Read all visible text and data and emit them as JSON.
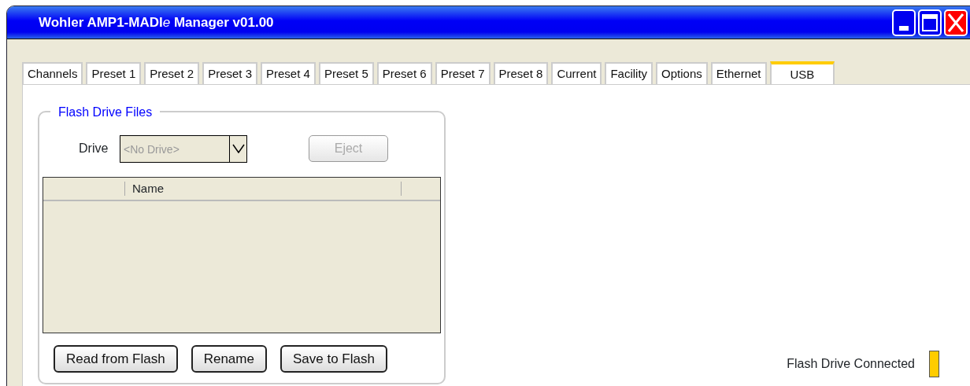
{
  "window": {
    "title": [
      {
        "text": "Wohler AMP1-MADI",
        "italic": false
      },
      {
        "text": "e",
        "italic": true
      },
      {
        "text": " Manager v01.00",
        "italic": false
      }
    ]
  },
  "tabs": [
    {
      "label": "Channels",
      "selected": false
    },
    {
      "label": "Preset 1",
      "selected": false
    },
    {
      "label": "Preset 2",
      "selected": false
    },
    {
      "label": "Preset 3",
      "selected": false
    },
    {
      "label": "Preset 4",
      "selected": false
    },
    {
      "label": "Preset 5",
      "selected": false
    },
    {
      "label": "Preset 6",
      "selected": false
    },
    {
      "label": "Preset 7",
      "selected": false
    },
    {
      "label": "Preset 8",
      "selected": false
    },
    {
      "label": "Current",
      "selected": false
    },
    {
      "label": "Facility",
      "selected": false
    },
    {
      "label": "Options",
      "selected": false
    },
    {
      "label": "Ethernet",
      "selected": false
    },
    {
      "label": "USB",
      "selected": true
    }
  ],
  "flash_drive_files": {
    "title": "Flash Drive Files",
    "drive_label": "Drive",
    "drive": {
      "value": "<No Drive>",
      "disabled": true
    },
    "eject": {
      "label": "Eject",
      "disabled": true
    },
    "table": {
      "columns": [
        "Name"
      ]
    },
    "buttons": [
      {
        "label": "Read from Flash",
        "disabled": false
      },
      {
        "label": "Rename",
        "disabled": false
      },
      {
        "label": "Save to Flash",
        "disabled": false
      }
    ]
  },
  "status": {
    "label": "Flash Drive Connected",
    "color": "#ffcc00"
  }
}
